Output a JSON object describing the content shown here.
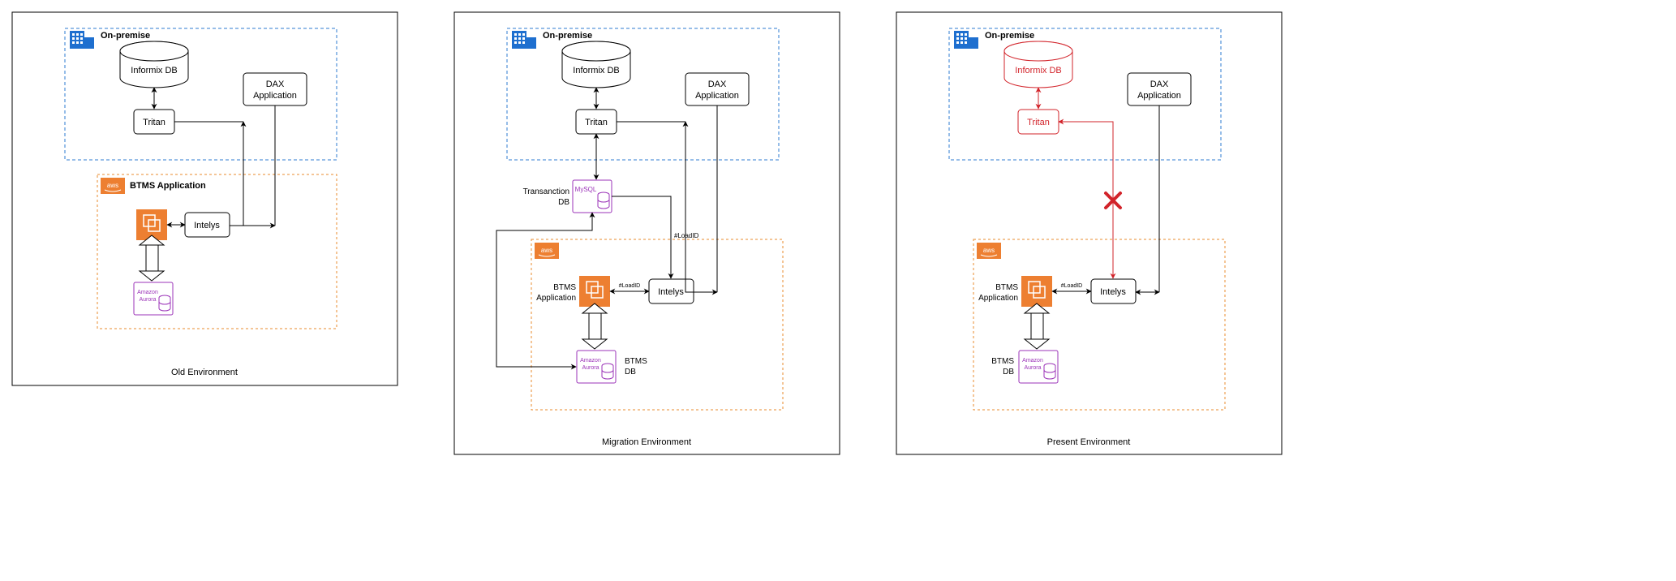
{
  "panels": [
    {
      "caption": "Old Environment",
      "onprem_label": "On-premise",
      "aws_label_inner": "BTMS Application",
      "informix": "Informix DB",
      "tritan": "Tritan",
      "dax1": "DAX",
      "dax2": "Application",
      "intelys": "Intelys",
      "aurora1": "Amazon",
      "aurora2": "Aurora"
    },
    {
      "caption": "Migration Environment",
      "onprem_label": "On-premise",
      "informix": "Informix DB",
      "tritan": "Tritan",
      "dax1": "DAX",
      "dax2": "Application",
      "trans1": "Transanction",
      "trans2": "DB",
      "mysql": "MySQL",
      "btms1": "BTMS",
      "btms2": "Application",
      "intelys": "Intelys",
      "aurora1": "Amazon",
      "aurora2": "Aurora",
      "btmsdb1": "BTMS",
      "btmsdb2": "DB",
      "loadid": "#LoadID"
    },
    {
      "caption": "Present Environment",
      "onprem_label": "On-premise",
      "informix": "Informix DB",
      "tritan": "Tritan",
      "dax1": "DAX",
      "dax2": "Application",
      "btms1": "BTMS",
      "btms2": "Application",
      "intelys": "Intelys",
      "aurora1": "Amazon",
      "aurora2": "Aurora",
      "btmsdb1": "BTMS",
      "btmsdb2": "DB",
      "loadid": "#LoadID"
    }
  ],
  "colors": {
    "onprem_border": "#2d7bd0",
    "aws_border": "#e88b2e",
    "aws_fill": "#ed7f31",
    "purple": "#9b33b8",
    "red": "#d2232a",
    "black": "#000000"
  }
}
